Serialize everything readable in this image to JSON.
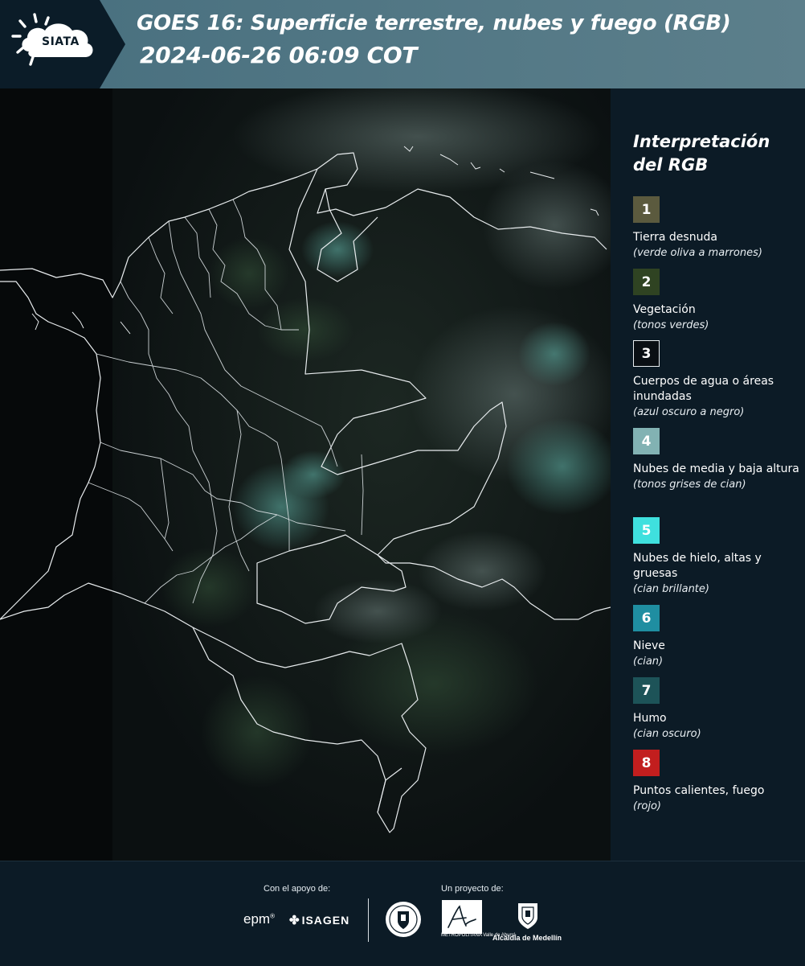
{
  "header": {
    "logo_text": "SIATA",
    "title_line1": "GOES 16: Superficie terrestre, nubes y fuego (RGB)",
    "title_line2": "2024-06-26 06:09 COT"
  },
  "map": {
    "product": "GOES 16 RGB",
    "imagery_tone": "dark nighttime composite with scattered cyan cloud patches",
    "boundary_color": "#e8ecee"
  },
  "legend": {
    "title_line1": "Interpretación",
    "title_line2": "del RGB",
    "items": [
      {
        "number": "1",
        "label": "Tierra desnuda",
        "note": "(verde oliva a marrones)",
        "color": "#5b5a3e",
        "border": ""
      },
      {
        "number": "2",
        "label": "Vegetación",
        "note": "(tonos verdes)",
        "color": "#2f4322",
        "border": ""
      },
      {
        "number": "3",
        "label": "Cuerpos de agua o áreas inundadas",
        "note": "(azul oscuro a negro)",
        "color": "#0a0f14",
        "border": "#e9eef1"
      },
      {
        "number": "4",
        "label": "Nubes de media y baja altura",
        "note": "(tonos grises de cian)",
        "color": "#82b2b3",
        "border": ""
      },
      {
        "number": "5",
        "label": "Nubes de hielo, altas y gruesas",
        "note": "(cian brillante)",
        "color": "#3fe0de",
        "border": ""
      },
      {
        "number": "6",
        "label": "Nieve",
        "note": "(cian)",
        "color": "#1f8ea1",
        "border": ""
      },
      {
        "number": "7",
        "label": "Humo",
        "note": "(cian oscuro)",
        "color": "#1d5358",
        "border": ""
      },
      {
        "number": "8",
        "label": "Puntos calientes, fuego",
        "note": "(rojo)",
        "color": "#c21e1e",
        "border": ""
      }
    ]
  },
  "footer": {
    "support_label": "Con el apoyo de:",
    "project_label": "Un proyecto de:",
    "sponsors": [
      "epm",
      "ISAGEN"
    ],
    "amva_caption": "METROPOLITANA Valle de Aburrá",
    "medellin_label": "Alcaldía de Medellín"
  }
}
